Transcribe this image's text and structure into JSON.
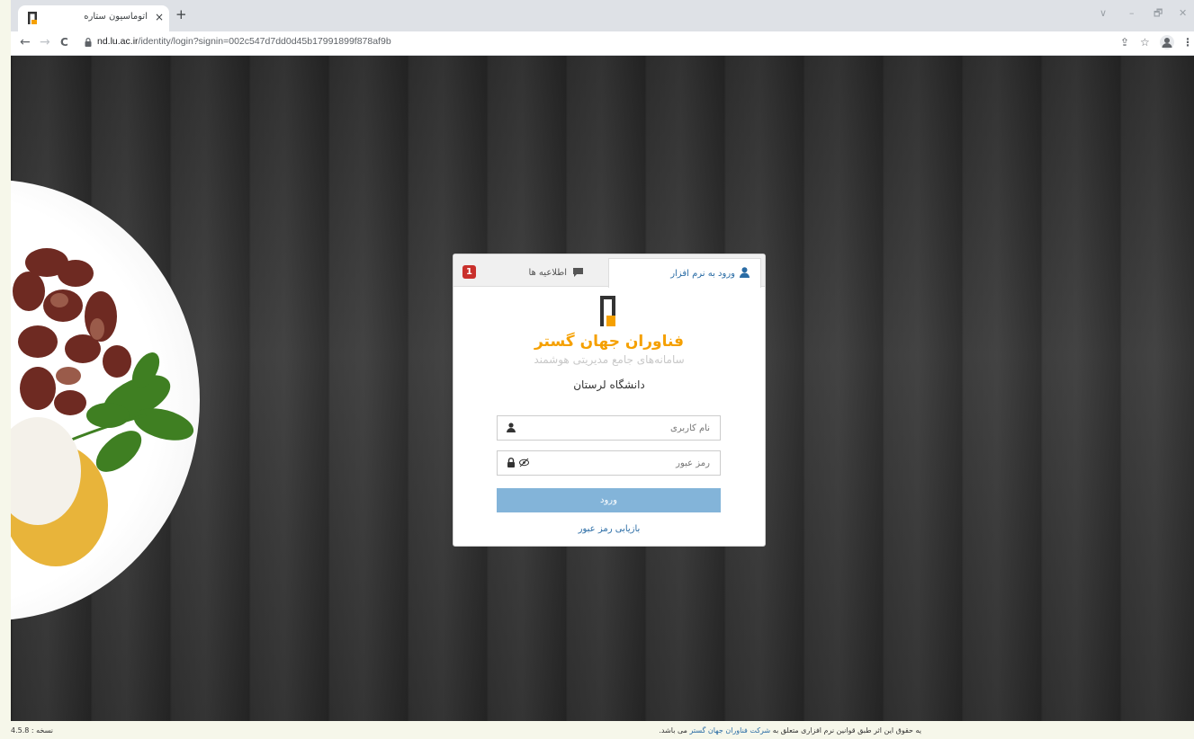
{
  "browser": {
    "tab_title": "اتوماسیون ستاره",
    "tab_close": "×",
    "new_tab": "+",
    "url_host": "nd.lu.ac.ir",
    "url_path": "/identity/login?signin=002c547d7dd0d45b17991899f878af9b",
    "nav": {
      "back": "←",
      "forward": "→",
      "reload": "C"
    },
    "window_controls": {
      "chevron": "∨",
      "minimize": "–",
      "restore": "🗗",
      "close": "✕"
    },
    "toolbar_icons": {
      "share": "⇪",
      "star": "☆",
      "menu": "⋮"
    }
  },
  "login": {
    "tab_login_label": "ورود به نرم افزار",
    "tab_news_label": "اطلاعیه ها",
    "news_count": "1",
    "brand_title": "فناوران جهان گستر",
    "brand_subtitle": "سامانه‌های جامع مدیریتی هوشمند",
    "organization": "دانشگاه لرستان",
    "username_placeholder": "نام کاربری",
    "password_placeholder": "رمز عبور",
    "submit_label": "ورود",
    "forgot_label": "بازیابی رمز عبور"
  },
  "footer": {
    "copyright_prefix": "یه حقوق این اثر طبق قوانین نرم افزاری متعلق به",
    "company_link": "شرکت فناوران جهان گستر",
    "copyright_suffix": "می باشد.",
    "version": "نسخه : 4.5.8"
  },
  "colors": {
    "brand_orange": "#f5a000",
    "link_blue": "#2a6ca5",
    "button_blue": "#83b4d9",
    "badge_red": "#c9302c"
  },
  "icons": {
    "user_tab": "user-icon",
    "news_tab": "comment-icon",
    "username_field": "user-icon",
    "password_field": "lock-icon",
    "password_toggle": "eye-slash-icon"
  }
}
